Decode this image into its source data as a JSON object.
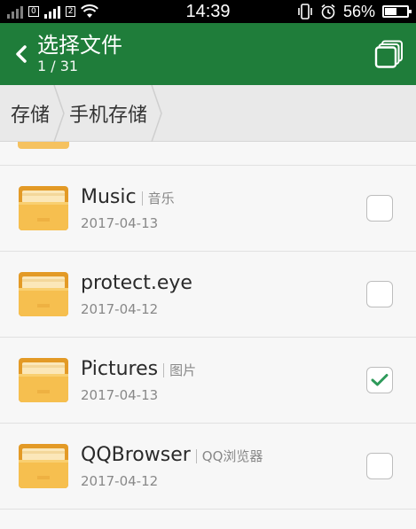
{
  "status_bar": {
    "time": "14:39",
    "battery_percent": "56%",
    "battery_level": 0.56,
    "sim_label": "0",
    "sim2_label": "2"
  },
  "header": {
    "title": "选择文件",
    "subtitle": "1 / 31",
    "back_icon": "chevron-left-icon",
    "multi_icon": "multi-window-icon",
    "color": "#1f7d3a"
  },
  "breadcrumb": {
    "items": [
      "存储",
      "手机存储"
    ]
  },
  "files": [
    {
      "name": "Music",
      "alias": "音乐",
      "date": "2017-04-13",
      "checked": false
    },
    {
      "name": "protect.eye",
      "alias": "",
      "date": "2017-04-12",
      "checked": false
    },
    {
      "name": "Pictures",
      "alias": "图片",
      "date": "2017-04-13",
      "checked": true
    },
    {
      "name": "QQBrowser",
      "alias": "QQ浏览器",
      "date": "2017-04-12",
      "checked": false
    }
  ],
  "colors": {
    "accent_green": "#1f7d3a",
    "check_green": "#2e9a5a",
    "folder_yellow": "#f5c260"
  }
}
